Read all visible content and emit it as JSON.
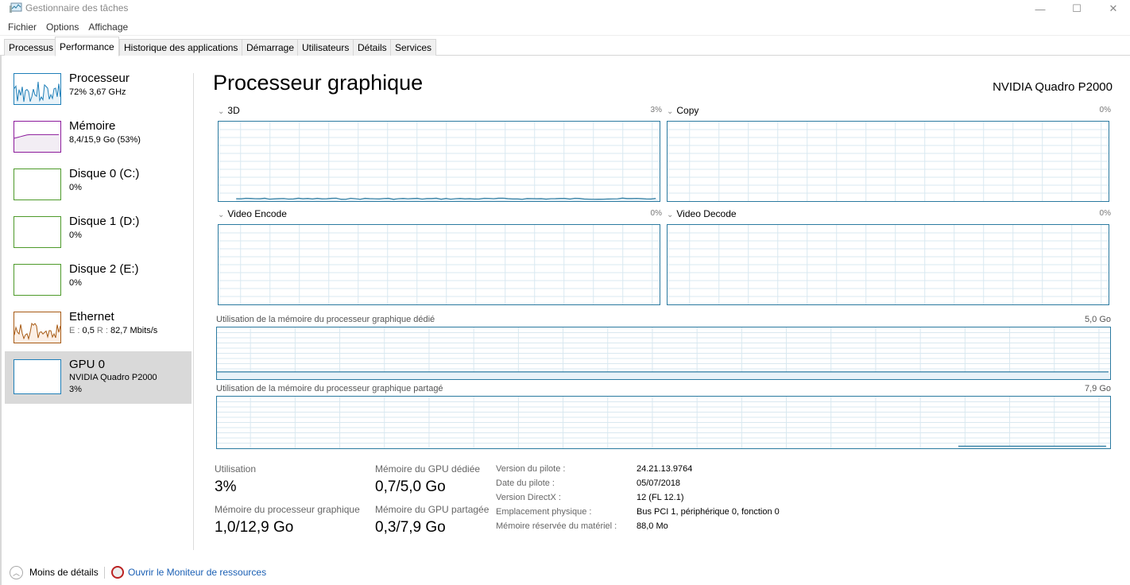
{
  "window": {
    "title": "Gestionnaire des tâches",
    "controls": {
      "minimize": "—",
      "maximize": "☐",
      "close": "✕"
    }
  },
  "menu": [
    "Fichier",
    "Options",
    "Affichage"
  ],
  "tabs": [
    {
      "label": "Processus",
      "active": false
    },
    {
      "label": "Performance",
      "active": true
    },
    {
      "label": "Historique des applications",
      "active": false
    },
    {
      "label": "Démarrage",
      "active": false
    },
    {
      "label": "Utilisateurs",
      "active": false
    },
    {
      "label": "Détails",
      "active": false
    },
    {
      "label": "Services",
      "active": false
    }
  ],
  "sidebar": {
    "items": [
      {
        "name": "Processeur",
        "sub": "72%  3,67 GHz",
        "color": "#1f7fb8",
        "fill": "#e9f3f9",
        "selected": false
      },
      {
        "name": "Mémoire",
        "sub": "8,4/15,9 Go (53%)",
        "color": "#8b1a9b",
        "fill": "#f2edf4",
        "selected": false
      },
      {
        "name": "Disque 0 (C:)",
        "sub": "0%",
        "color": "#4d9a2a",
        "fill": "#ffffff",
        "selected": false
      },
      {
        "name": "Disque 1 (D:)",
        "sub": "0%",
        "color": "#4d9a2a",
        "fill": "#ffffff",
        "selected": false
      },
      {
        "name": "Disque 2 (E:)",
        "sub": "0%",
        "color": "#4d9a2a",
        "fill": "#ffffff",
        "selected": false
      },
      {
        "name": "Ethernet",
        "sub_e_label": "E :",
        "sub_e": "0,5",
        "sub_r_label": "R :",
        "sub_r": "82,7 Mbits/s",
        "color": "#a75a14",
        "fill": "#fcefe5",
        "selected": false
      },
      {
        "name": "GPU 0",
        "sub": "NVIDIA Quadro P2000",
        "sub2": "3%",
        "color": "#1f7fb8",
        "fill": "#ffffff",
        "selected": true
      }
    ]
  },
  "main": {
    "title": "Processeur graphique",
    "gpu_name": "NVIDIA Quadro P2000",
    "engines": [
      {
        "label": "3D",
        "percent": "3%",
        "usage_pct": 3
      },
      {
        "label": "Copy",
        "percent": "0%",
        "usage_pct": 0
      },
      {
        "label": "Video Encode",
        "percent": "0%",
        "usage_pct": 0
      },
      {
        "label": "Video Decode",
        "percent": "0%",
        "usage_pct": 0
      }
    ],
    "memory_graphs": [
      {
        "label": "Utilisation de la mémoire du processeur graphique dédié",
        "max": "5,0 Go",
        "used_fraction": 0.14
      },
      {
        "label": "Utilisation de la mémoire du processeur graphique partagé",
        "max": "7,9 Go",
        "used_fraction": 0.04
      }
    ],
    "stats": {
      "utilisation_label": "Utilisation",
      "utilisation_value": "3%",
      "gpu_mem_label": "Mémoire du processeur graphique",
      "gpu_mem_value": "1,0/12,9 Go",
      "dedicated_label": "Mémoire du GPU dédiée",
      "dedicated_value": "0,7/5,0 Go",
      "shared_label": "Mémoire du GPU partagée",
      "shared_value": "0,3/7,9 Go"
    },
    "info": [
      {
        "key": "Version du pilote :",
        "value": "24.21.13.9764"
      },
      {
        "key": "Date du pilote :",
        "value": "05/07/2018"
      },
      {
        "key": "Version DirectX :",
        "value": "12 (FL 12.1)"
      },
      {
        "key": "Emplacement physique :",
        "value": "Bus PCI 1, périphérique 0, fonction 0"
      },
      {
        "key": "Mémoire réservée du matériel :",
        "value": "88,0 Mo"
      }
    ]
  },
  "footer": {
    "less_details": "Moins de détails",
    "open_resmon": "Ouvrir le Moniteur de ressources"
  },
  "colors": {
    "graph_border": "#2b7aa0",
    "grid": "#d9e8f0",
    "link": "#1a5fb4"
  }
}
